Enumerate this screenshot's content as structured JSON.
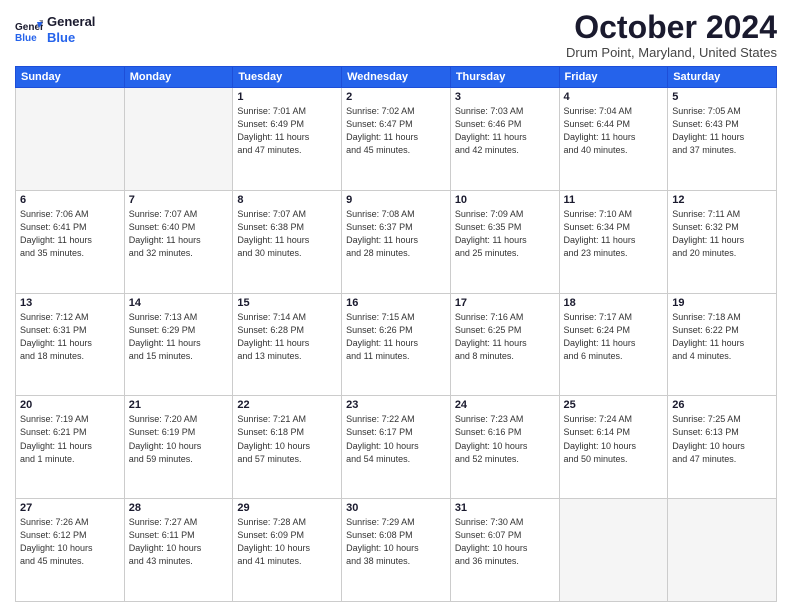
{
  "header": {
    "logo_general": "General",
    "logo_blue": "Blue",
    "month_title": "October 2024",
    "location": "Drum Point, Maryland, United States"
  },
  "weekdays": [
    "Sunday",
    "Monday",
    "Tuesday",
    "Wednesday",
    "Thursday",
    "Friday",
    "Saturday"
  ],
  "weeks": [
    [
      {
        "day": "",
        "info": "",
        "empty": true
      },
      {
        "day": "",
        "info": "",
        "empty": true
      },
      {
        "day": "1",
        "info": "Sunrise: 7:01 AM\nSunset: 6:49 PM\nDaylight: 11 hours\nand 47 minutes.",
        "empty": false
      },
      {
        "day": "2",
        "info": "Sunrise: 7:02 AM\nSunset: 6:47 PM\nDaylight: 11 hours\nand 45 minutes.",
        "empty": false
      },
      {
        "day": "3",
        "info": "Sunrise: 7:03 AM\nSunset: 6:46 PM\nDaylight: 11 hours\nand 42 minutes.",
        "empty": false
      },
      {
        "day": "4",
        "info": "Sunrise: 7:04 AM\nSunset: 6:44 PM\nDaylight: 11 hours\nand 40 minutes.",
        "empty": false
      },
      {
        "day": "5",
        "info": "Sunrise: 7:05 AM\nSunset: 6:43 PM\nDaylight: 11 hours\nand 37 minutes.",
        "empty": false
      }
    ],
    [
      {
        "day": "6",
        "info": "Sunrise: 7:06 AM\nSunset: 6:41 PM\nDaylight: 11 hours\nand 35 minutes.",
        "empty": false
      },
      {
        "day": "7",
        "info": "Sunrise: 7:07 AM\nSunset: 6:40 PM\nDaylight: 11 hours\nand 32 minutes.",
        "empty": false
      },
      {
        "day": "8",
        "info": "Sunrise: 7:07 AM\nSunset: 6:38 PM\nDaylight: 11 hours\nand 30 minutes.",
        "empty": false
      },
      {
        "day": "9",
        "info": "Sunrise: 7:08 AM\nSunset: 6:37 PM\nDaylight: 11 hours\nand 28 minutes.",
        "empty": false
      },
      {
        "day": "10",
        "info": "Sunrise: 7:09 AM\nSunset: 6:35 PM\nDaylight: 11 hours\nand 25 minutes.",
        "empty": false
      },
      {
        "day": "11",
        "info": "Sunrise: 7:10 AM\nSunset: 6:34 PM\nDaylight: 11 hours\nand 23 minutes.",
        "empty": false
      },
      {
        "day": "12",
        "info": "Sunrise: 7:11 AM\nSunset: 6:32 PM\nDaylight: 11 hours\nand 20 minutes.",
        "empty": false
      }
    ],
    [
      {
        "day": "13",
        "info": "Sunrise: 7:12 AM\nSunset: 6:31 PM\nDaylight: 11 hours\nand 18 minutes.",
        "empty": false
      },
      {
        "day": "14",
        "info": "Sunrise: 7:13 AM\nSunset: 6:29 PM\nDaylight: 11 hours\nand 15 minutes.",
        "empty": false
      },
      {
        "day": "15",
        "info": "Sunrise: 7:14 AM\nSunset: 6:28 PM\nDaylight: 11 hours\nand 13 minutes.",
        "empty": false
      },
      {
        "day": "16",
        "info": "Sunrise: 7:15 AM\nSunset: 6:26 PM\nDaylight: 11 hours\nand 11 minutes.",
        "empty": false
      },
      {
        "day": "17",
        "info": "Sunrise: 7:16 AM\nSunset: 6:25 PM\nDaylight: 11 hours\nand 8 minutes.",
        "empty": false
      },
      {
        "day": "18",
        "info": "Sunrise: 7:17 AM\nSunset: 6:24 PM\nDaylight: 11 hours\nand 6 minutes.",
        "empty": false
      },
      {
        "day": "19",
        "info": "Sunrise: 7:18 AM\nSunset: 6:22 PM\nDaylight: 11 hours\nand 4 minutes.",
        "empty": false
      }
    ],
    [
      {
        "day": "20",
        "info": "Sunrise: 7:19 AM\nSunset: 6:21 PM\nDaylight: 11 hours\nand 1 minute.",
        "empty": false
      },
      {
        "day": "21",
        "info": "Sunrise: 7:20 AM\nSunset: 6:19 PM\nDaylight: 10 hours\nand 59 minutes.",
        "empty": false
      },
      {
        "day": "22",
        "info": "Sunrise: 7:21 AM\nSunset: 6:18 PM\nDaylight: 10 hours\nand 57 minutes.",
        "empty": false
      },
      {
        "day": "23",
        "info": "Sunrise: 7:22 AM\nSunset: 6:17 PM\nDaylight: 10 hours\nand 54 minutes.",
        "empty": false
      },
      {
        "day": "24",
        "info": "Sunrise: 7:23 AM\nSunset: 6:16 PM\nDaylight: 10 hours\nand 52 minutes.",
        "empty": false
      },
      {
        "day": "25",
        "info": "Sunrise: 7:24 AM\nSunset: 6:14 PM\nDaylight: 10 hours\nand 50 minutes.",
        "empty": false
      },
      {
        "day": "26",
        "info": "Sunrise: 7:25 AM\nSunset: 6:13 PM\nDaylight: 10 hours\nand 47 minutes.",
        "empty": false
      }
    ],
    [
      {
        "day": "27",
        "info": "Sunrise: 7:26 AM\nSunset: 6:12 PM\nDaylight: 10 hours\nand 45 minutes.",
        "empty": false
      },
      {
        "day": "28",
        "info": "Sunrise: 7:27 AM\nSunset: 6:11 PM\nDaylight: 10 hours\nand 43 minutes.",
        "empty": false
      },
      {
        "day": "29",
        "info": "Sunrise: 7:28 AM\nSunset: 6:09 PM\nDaylight: 10 hours\nand 41 minutes.",
        "empty": false
      },
      {
        "day": "30",
        "info": "Sunrise: 7:29 AM\nSunset: 6:08 PM\nDaylight: 10 hours\nand 38 minutes.",
        "empty": false
      },
      {
        "day": "31",
        "info": "Sunrise: 7:30 AM\nSunset: 6:07 PM\nDaylight: 10 hours\nand 36 minutes.",
        "empty": false
      },
      {
        "day": "",
        "info": "",
        "empty": true
      },
      {
        "day": "",
        "info": "",
        "empty": true
      }
    ]
  ]
}
